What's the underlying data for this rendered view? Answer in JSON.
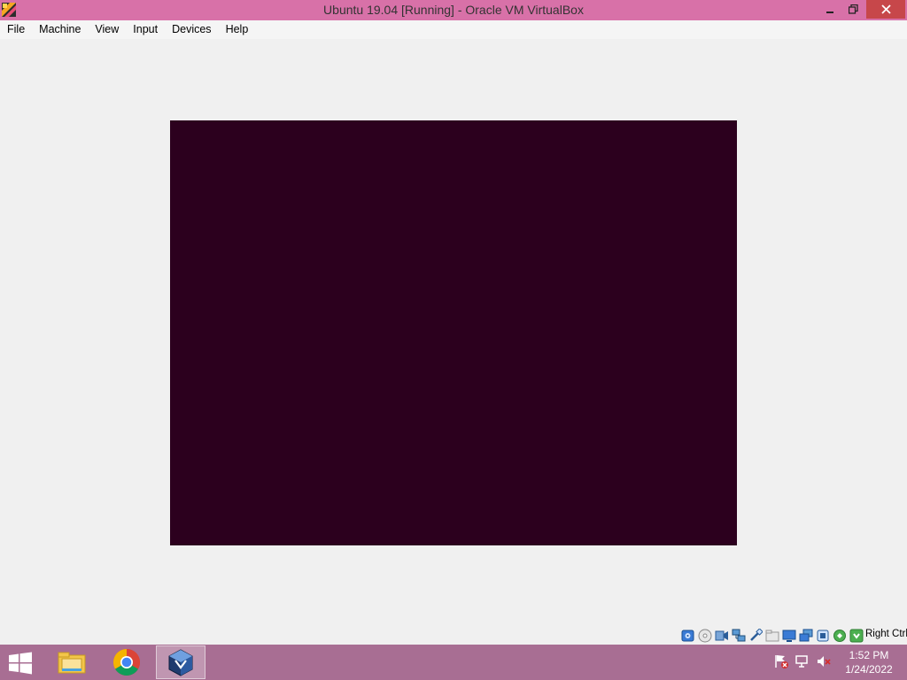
{
  "window": {
    "title": "Ubuntu 19.04 [Running] - Oracle VM VirtualBox",
    "icon": "virtualbox-app-icon",
    "controls": {
      "minimize": "minimize-icon",
      "maximize": "restore-icon",
      "close": "close-icon"
    }
  },
  "menu": {
    "items": [
      "File",
      "Machine",
      "View",
      "Input",
      "Devices",
      "Help"
    ]
  },
  "vm_screen": {
    "background_color": "#2c001e"
  },
  "statusbar": {
    "icons": [
      "hard-disk-icon",
      "optical-drive-icon",
      "audio-icon",
      "network-icon",
      "usb-icon",
      "shared-folders-icon",
      "display-icon",
      "video-capture-icon",
      "cpu-icon",
      "mouse-integration-icon",
      "keyboard-capture-icon"
    ],
    "host_key": "Right Ctrl"
  },
  "taskbar": {
    "apps": [
      "file-explorer-icon",
      "chrome-icon",
      "virtualbox-icon"
    ],
    "tray_icons": [
      "action-center-flag-icon",
      "network-icon",
      "volume-muted-icon"
    ],
    "time": "1:52 PM",
    "date": "1/24/2022"
  },
  "colors": {
    "titlebar": "#d871a8",
    "taskbar": "#a86e93",
    "close_button": "#c7474a",
    "vm_background": "#2c001e"
  }
}
